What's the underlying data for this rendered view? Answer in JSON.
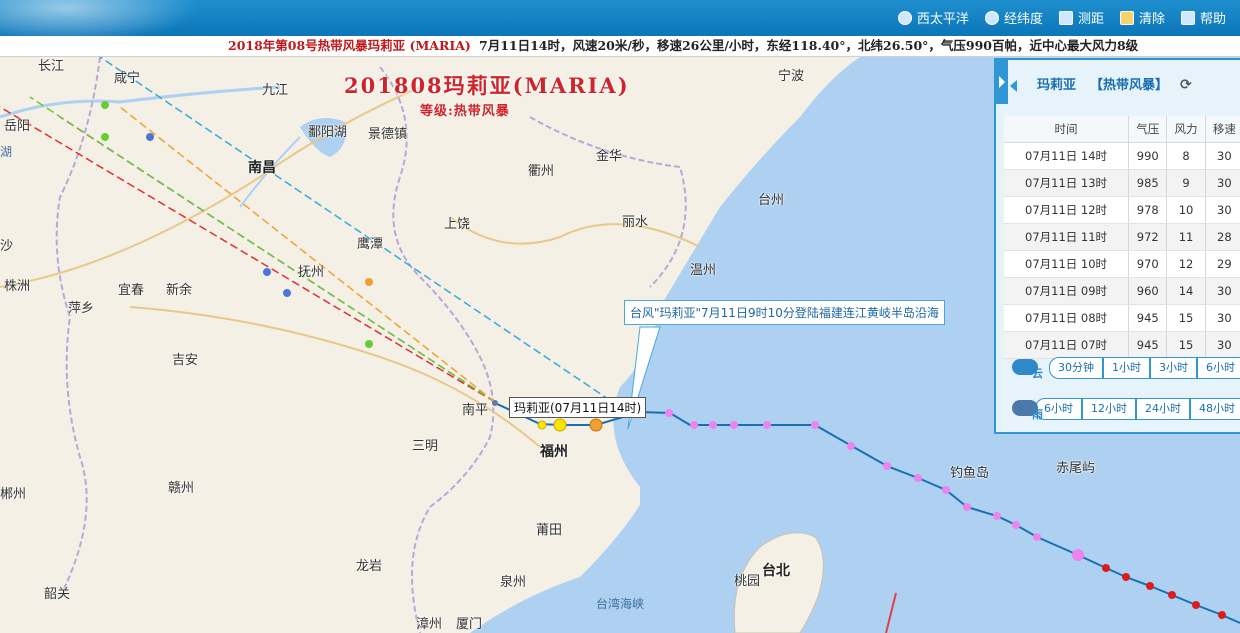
{
  "topnav": [
    {
      "label": "西太平洋",
      "icon": "globe-icon"
    },
    {
      "label": "经纬度",
      "icon": "grid-globe-icon"
    },
    {
      "label": "测距",
      "icon": "ruler-icon"
    },
    {
      "label": "清除",
      "icon": "broom-icon"
    },
    {
      "label": "帮助",
      "icon": "help-icon"
    }
  ],
  "infobar": {
    "title": "2018年第08号热带风暴玛莉亚 (MARIA)",
    "detail": "7月11日14时，风速20米/秒，移速26公里/小时，东经118.40°，北纬26.50°，气压990百帕，近中心最大风力8级"
  },
  "map": {
    "title": "201808玛莉亚(MARIA)",
    "subtitle": "等级:热带风暴",
    "landfall_note": "台风\"玛莉亚\"7月11日9时10分登陆福建连江黄岐半岛沿海",
    "current_label": "玛莉亚(07月11日14时)",
    "places": [
      "长江",
      "咸宁",
      "九江",
      "宁波",
      "岳阳",
      "鄱阳湖",
      "景德镇",
      "南昌",
      "金华",
      "衢州",
      "湖",
      "台州",
      "丽水",
      "上饶",
      "鹰潭",
      "沙",
      "株洲",
      "萍乡",
      "宜春",
      "新余",
      "抚州",
      "温州",
      "吉安",
      "南平",
      "三明",
      "福州",
      "钓鱼岛",
      "赤尾屿",
      "赣州",
      "郴州",
      "莆田",
      "龙岩",
      "泉州",
      "台北",
      "桃园",
      "台湾海峡",
      "韶关",
      "漳州",
      "厦门"
    ],
    "colors": {
      "track_past": "#1a6fb0",
      "point_td": "#ee82ee",
      "point_ts": "#f0a030",
      "point_sts": "#ffe600",
      "point_ty": "#dd1c1c",
      "forecast_china": "#e03030",
      "forecast_jp": "#9933ff",
      "forecast_us": "#33aadd",
      "forecast_kr": "#66cc33",
      "sea": "#aed1f2",
      "land": "#f5f0e6"
    }
  },
  "panel": {
    "name": "玛莉亚",
    "level": "【热带风暴】",
    "columns": [
      "时间",
      "气压",
      "风力",
      "移速"
    ],
    "rows": [
      {
        "time": "07月11日 14时",
        "pressure": "990",
        "force": "8",
        "speed": "30"
      },
      {
        "time": "07月11日 13时",
        "pressure": "985",
        "force": "9",
        "speed": "30"
      },
      {
        "time": "07月11日 12时",
        "pressure": "978",
        "force": "10",
        "speed": "30"
      },
      {
        "time": "07月11日 11时",
        "pressure": "972",
        "force": "11",
        "speed": "28"
      },
      {
        "time": "07月11日 10时",
        "pressure": "970",
        "force": "12",
        "speed": "29"
      },
      {
        "time": "07月11日 09时",
        "pressure": "960",
        "force": "14",
        "speed": "30"
      },
      {
        "time": "07月11日 08时",
        "pressure": "945",
        "force": "15",
        "speed": "30"
      },
      {
        "time": "07月11日 07时",
        "pressure": "945",
        "force": "15",
        "speed": "30"
      }
    ],
    "cloud_label": "云",
    "cloud_buttons": [
      "30分钟",
      "1小时",
      "3小时",
      "6小时"
    ],
    "rain_label": "雨",
    "rain_buttons": [
      "6小时",
      "12小时",
      "24小时",
      "48小时"
    ]
  }
}
